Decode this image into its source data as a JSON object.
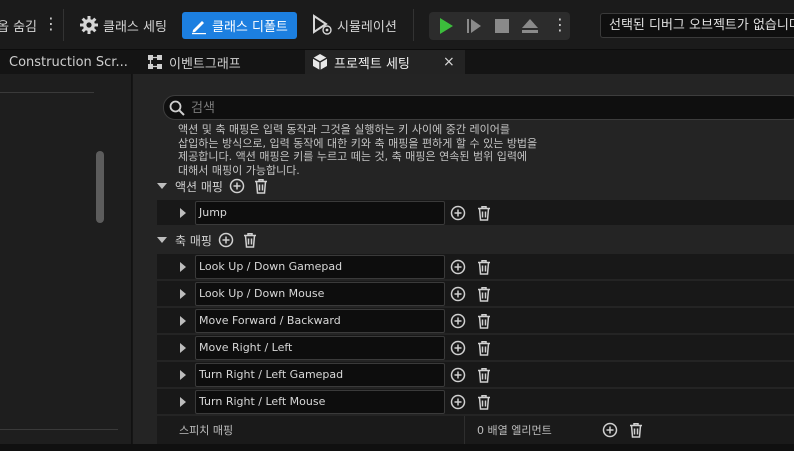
{
  "toolbar": {
    "hide_label": "옵 숨김",
    "class_settings": "클래스 세팅",
    "class_defaults": "클래스 디폴트",
    "simulation": "시뮬레이션",
    "debug_object": "선택된 디버그 오브젝트가 없습니다"
  },
  "tabs": [
    {
      "label": "Construction Scr..."
    },
    {
      "label": "이벤트그래프"
    },
    {
      "label": "프로젝트 세팅",
      "close": "×"
    }
  ],
  "search": {
    "placeholder": "검색"
  },
  "description": {
    "line1": "액션 및 축 매핑은 입력 동작과 그것을 실행하는 키 사이에 중간 레이어를",
    "line2": "삽입하는 방식으로, 입력 동작에 대한 키와 축 매핑을 편하게 할 수 있는 방법을",
    "line3": "제공합니다. 액션 매핑은 키를 누르고 떼는 것, 축 매핑은 연속된 범위 입력에",
    "line4": "대해서 매핑이 가능합니다."
  },
  "action_mappings": {
    "label": "액션 매핑",
    "items": [
      {
        "name": "Jump"
      }
    ]
  },
  "axis_mappings": {
    "label": "축 매핑",
    "items": [
      {
        "name": "Look Up / Down Gamepad"
      },
      {
        "name": "Look Up / Down Mouse"
      },
      {
        "name": "Move Forward / Backward"
      },
      {
        "name": "Move Right / Left"
      },
      {
        "name": "Turn Right / Left Gamepad"
      },
      {
        "name": "Turn Right / Left Mouse"
      }
    ]
  },
  "speech_mappings": {
    "label": "스피치 매핑",
    "count": "0 배열 엘리먼트"
  },
  "colors": {
    "accent": "#1c7fe0",
    "play_green": "#3cbd3c"
  }
}
